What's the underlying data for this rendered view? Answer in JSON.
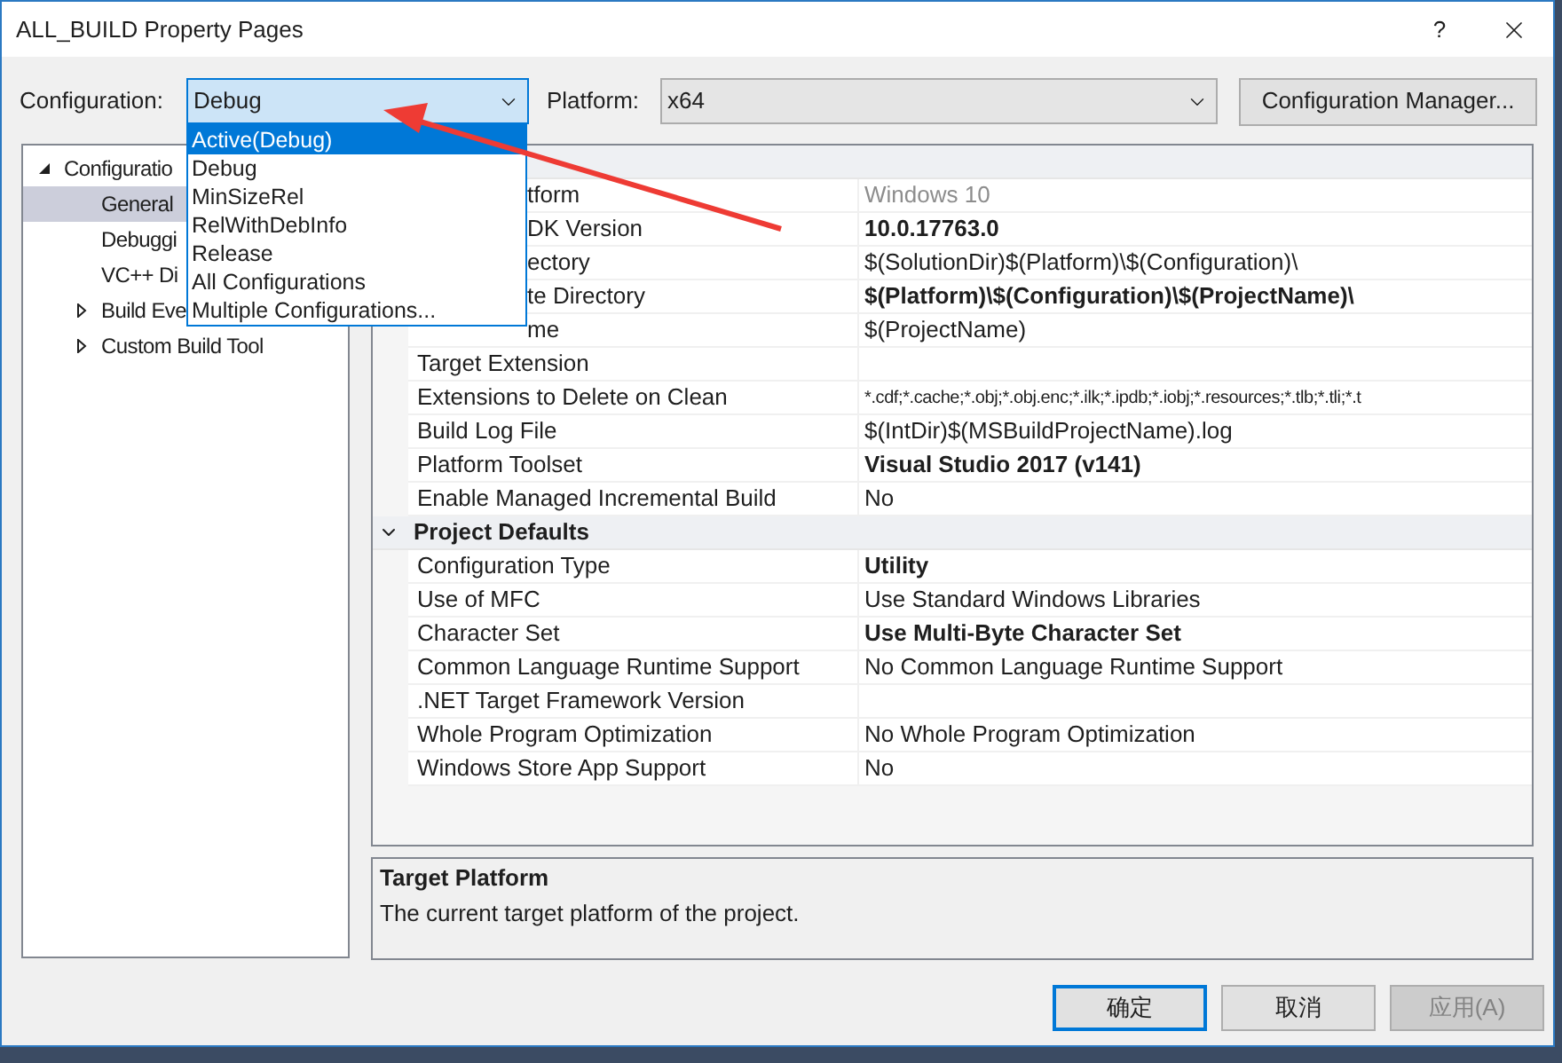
{
  "window": {
    "title": "ALL_BUILD Property Pages",
    "help": "?"
  },
  "toolbar": {
    "configuration_label": "Configuration:",
    "configuration_value": "Debug",
    "platform_label": "Platform:",
    "platform_value": "x64",
    "manager_button": "Configuration Manager..."
  },
  "configuration_dropdown": [
    {
      "label": "Active(Debug)",
      "selected": true
    },
    {
      "label": "Debug",
      "selected": false
    },
    {
      "label": "MinSizeRel",
      "selected": false
    },
    {
      "label": "RelWithDebInfo",
      "selected": false
    },
    {
      "label": "Release",
      "selected": false
    },
    {
      "label": "All Configurations",
      "selected": false
    },
    {
      "label": "Multiple Configurations...",
      "selected": false
    }
  ],
  "tree": [
    {
      "label": "Configuratio",
      "expanded": true,
      "selected": false,
      "children": [
        {
          "label": "General",
          "selected": true
        },
        {
          "label": "Debuggi",
          "selected": false
        },
        {
          "label": "VC++ Di",
          "selected": false
        },
        {
          "label": "Build Eve",
          "expanded": false,
          "selected": false
        },
        {
          "label": "Custom Build Tool",
          "expanded": false,
          "selected": false
        }
      ]
    }
  ],
  "property_groups": [
    {
      "expanded": true,
      "rows": [
        {
          "name": "tform",
          "covered": true,
          "value": "Windows 10",
          "bold": false,
          "disabled": true
        },
        {
          "name": "DK Version",
          "covered": true,
          "value": "10.0.17763.0",
          "bold": true,
          "disabled": false
        },
        {
          "name": "ectory",
          "covered": true,
          "value": "$(SolutionDir)$(Platform)\\$(Configuration)\\",
          "bold": false,
          "disabled": false
        },
        {
          "name": "te Directory",
          "covered": true,
          "value": "$(Platform)\\$(Configuration)\\$(ProjectName)\\",
          "bold": true,
          "disabled": false
        },
        {
          "name": "me",
          "covered": true,
          "value": "$(ProjectName)",
          "bold": false,
          "disabled": false
        },
        {
          "name": "Target Extension",
          "covered": false
        },
        {
          "name": "Extensions to Delete on Clean",
          "covered": false,
          "value": "*.cdf;*.cache;*.obj;*.obj.enc;*.ilk;*.ipdb;*.iobj;*.resources;*.tlb;*.tli;*.t",
          "bold": false,
          "disabled": false
        },
        {
          "name": "Build Log File",
          "covered": false,
          "value": "$(IntDir)$(MSBuildProjectName).log",
          "bold": false,
          "disabled": false
        },
        {
          "name": "Platform Toolset",
          "covered": false,
          "value": "Visual Studio 2017 (v141)",
          "bold": true,
          "disabled": false
        },
        {
          "name": "Enable Managed Incremental Build",
          "covered": false,
          "value": "No",
          "bold": false,
          "disabled": false
        }
      ]
    },
    {
      "title": "Project Defaults",
      "expanded": true,
      "rows": [
        {
          "name": "Configuration Type",
          "covered": false,
          "value": "Utility",
          "bold": true,
          "disabled": false
        },
        {
          "name": "Use of MFC",
          "covered": false,
          "value": "Use Standard Windows Libraries",
          "bold": false,
          "disabled": false
        },
        {
          "name": "Character Set",
          "covered": false,
          "value": "Use Multi-Byte Character Set",
          "bold": true,
          "disabled": false
        },
        {
          "name": "Common Language Runtime Support",
          "covered": false,
          "value": "No Common Language Runtime Support",
          "bold": false,
          "disabled": false
        },
        {
          "name": ".NET Target Framework Version",
          "covered": false
        },
        {
          "name": "Whole Program Optimization",
          "covered": false,
          "value": "No Whole Program Optimization",
          "bold": false,
          "disabled": false
        },
        {
          "name": "Windows Store App Support",
          "covered": false,
          "value": "No",
          "bold": false,
          "disabled": false
        }
      ]
    }
  ],
  "description": {
    "title": "Target Platform",
    "text": "The current target platform of the project."
  },
  "buttons": [
    {
      "label": "确定",
      "focused": true,
      "disabled": false
    },
    {
      "label": "取消",
      "focused": false,
      "disabled": false
    },
    {
      "label": "应用(A)",
      "focused": false,
      "disabled": true
    }
  ]
}
